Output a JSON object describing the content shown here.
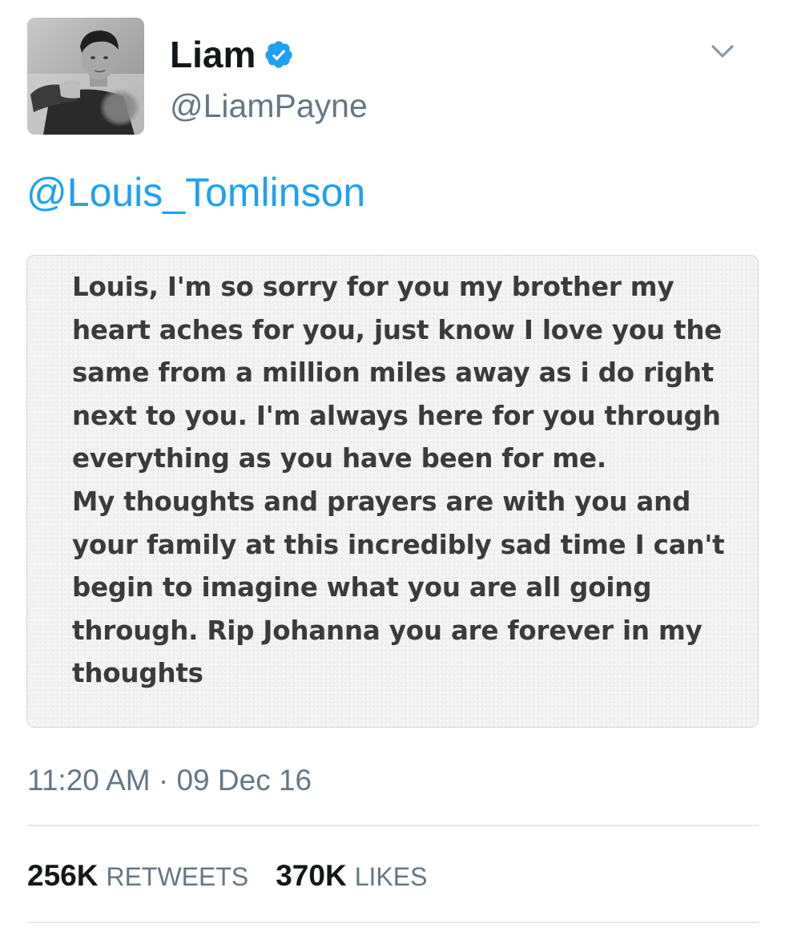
{
  "tweet": {
    "author": {
      "display_name": "Liam",
      "handle": "@LiamPayne",
      "verified": true,
      "avatar_icon": "profile-photo"
    },
    "menu_icon": "chevron-down-icon",
    "reply_to": "@Louis_Tomlinson",
    "media_text_lines": [
      "Louis, I'm so sorry for you my brother my",
      "heart aches for you, just know I love you the",
      "same from a million miles away as i do right",
      "next to you. I'm always here for you through",
      "everything as you have been for me.",
      "My thoughts and prayers are with you and",
      "your family at this incredibly sad time I can't",
      "begin to imagine what you are all going",
      "through. Rip Johanna you are forever in my",
      "thoughts"
    ],
    "timestamp": "11:20 AM · 09 Dec 16",
    "stats": {
      "retweets_count": "256K",
      "retweets_label": "RETWEETS",
      "likes_count": "370K",
      "likes_label": "LIKES"
    }
  },
  "colors": {
    "link": "#1da1f2",
    "verified": "#1da1f2",
    "secondary_text": "#657786",
    "primary_text": "#14171a",
    "divider": "#e1e8ed"
  }
}
